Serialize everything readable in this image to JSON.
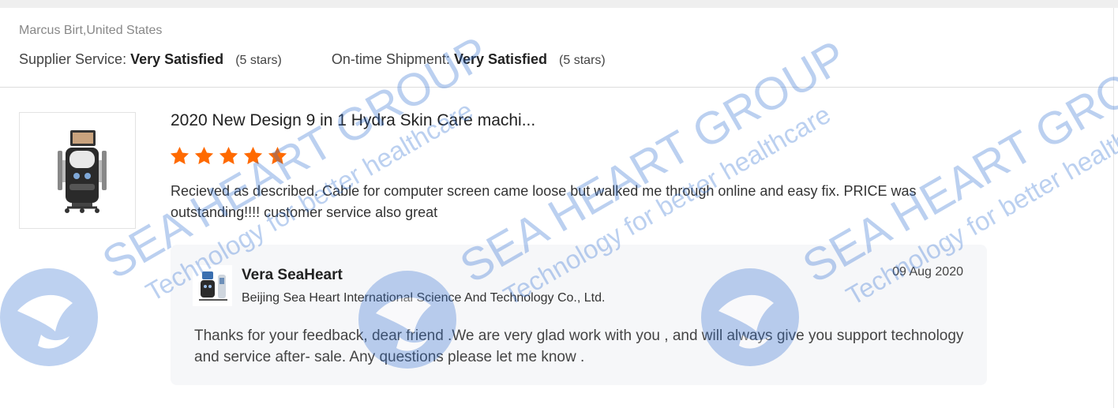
{
  "reviewer": {
    "line": "Marcus Birt,United States"
  },
  "ratings": [
    {
      "label": "Supplier Service:",
      "value": "Very Satisfied",
      "stars": "(5 stars)"
    },
    {
      "label": "On-time Shipment:",
      "value": "Very Satisfied",
      "stars": "(5 stars)"
    }
  ],
  "product": {
    "title": "2020 New Design 9 in 1 Hydra Skin Care machi...",
    "rating": 5,
    "star_color": "#ff6a00",
    "review": "Recieved as described. Cable for computer screen came loose but walked me through online and easy fix. PRICE was outstanding!!!! customer service also great"
  },
  "reply": {
    "name": "Vera SeaHeart",
    "company": "Beijing Sea Heart International Science And Technology Co., Ltd.",
    "date": "09 Aug 2020",
    "text": "Thanks for your feedback, dear friend .We are very glad work with you , and will always give you support technology and service after- sale. Any questions please let me know ."
  },
  "watermark": {
    "brand": "SEA HEART GROUP",
    "tagline": "Technology for better healthcare",
    "color": "#2f6fd1"
  },
  "icons": {
    "product_thumbnail": "hydra-machine-image",
    "reply_avatar": "seller-avatar",
    "rating": "star-icon"
  }
}
